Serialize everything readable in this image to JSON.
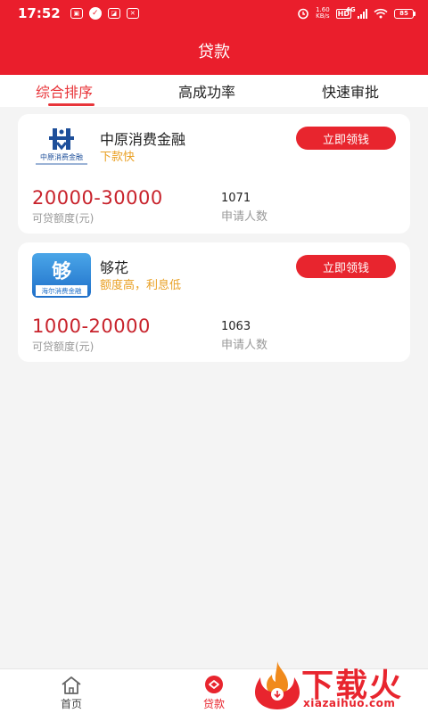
{
  "status_bar": {
    "time": "17:52",
    "net_speed_value": "1.60",
    "net_speed_unit": "KB/s",
    "hd_label": "HD",
    "signal_label": "4G",
    "battery_level": "85",
    "notif_icons": [
      "app-icon",
      "check-icon",
      "image-icon",
      "flame-icon"
    ]
  },
  "header": {
    "title": "贷款"
  },
  "tabs": [
    {
      "label": "综合排序",
      "active": true
    },
    {
      "label": "高成功率",
      "active": false
    },
    {
      "label": "快速审批",
      "active": false
    }
  ],
  "products": [
    {
      "name": "中原消费金融",
      "tag": "下款快",
      "apply_label": "立即领钱",
      "amount_range": "20000-30000",
      "amount_label": "可贷额度(元)",
      "applicants": "1071",
      "applicants_label": "申请人数",
      "logo_text": "中原消费金融"
    },
    {
      "name": "够花",
      "tag": "额度高，利息低",
      "apply_label": "立即领钱",
      "amount_range": "1000-20000",
      "amount_label": "可贷额度(元)",
      "applicants": "1063",
      "applicants_label": "申请人数",
      "logo_text": "海尔消费金融"
    }
  ],
  "bottom_nav": [
    {
      "label": "首页",
      "icon": "home-icon",
      "active": false
    },
    {
      "label": "贷款",
      "icon": "loan-icon",
      "active": true
    }
  ],
  "watermark": {
    "text": "下载火",
    "sub": "xiazaihuo.com"
  },
  "colors": {
    "brand_red": "#ea1e2c",
    "amount_red": "#c8232c",
    "tag_orange": "#e9a024"
  }
}
